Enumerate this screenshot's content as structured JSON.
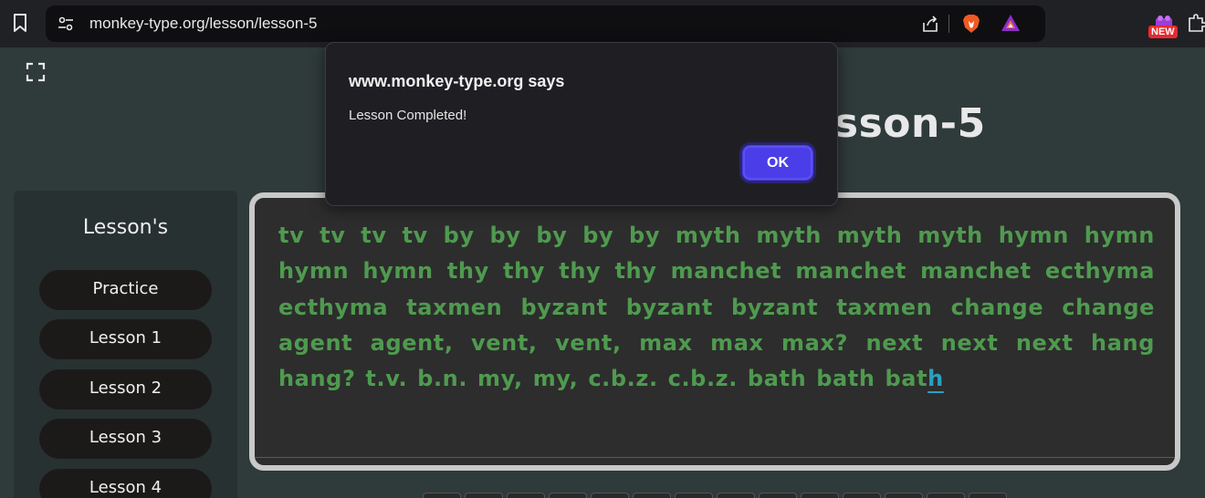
{
  "browser": {
    "url": "monkey-type.org/lesson/lesson-5",
    "new_badge": "NEW"
  },
  "page": {
    "title": "Lesson-5",
    "sidebar": {
      "title": "Lesson's",
      "items": [
        {
          "label": "Practice"
        },
        {
          "label": "Lesson 1"
        },
        {
          "label": "Lesson 2"
        },
        {
          "label": "Lesson 3"
        },
        {
          "label": "Lesson 4"
        }
      ]
    },
    "typing": {
      "typed_text": "tv tv tv tv by by by by by myth myth myth myth hymn hymn hymn hymn thy thy thy thy manchet manchet manchet ecthyma ecthyma taxmen byzant byzant byzant taxmen change change agent agent, vent, vent, max max max? next next next hang hang? t.v. b.n. my, my, c.b.z. c.b.z. bath bath bat",
      "current_char": "h",
      "typed_color": "#4f9a4f",
      "current_color": "#2aa0c0"
    }
  },
  "alert": {
    "title": "www.monkey-type.org says",
    "message": "Lesson Completed!",
    "ok_label": "OK"
  }
}
